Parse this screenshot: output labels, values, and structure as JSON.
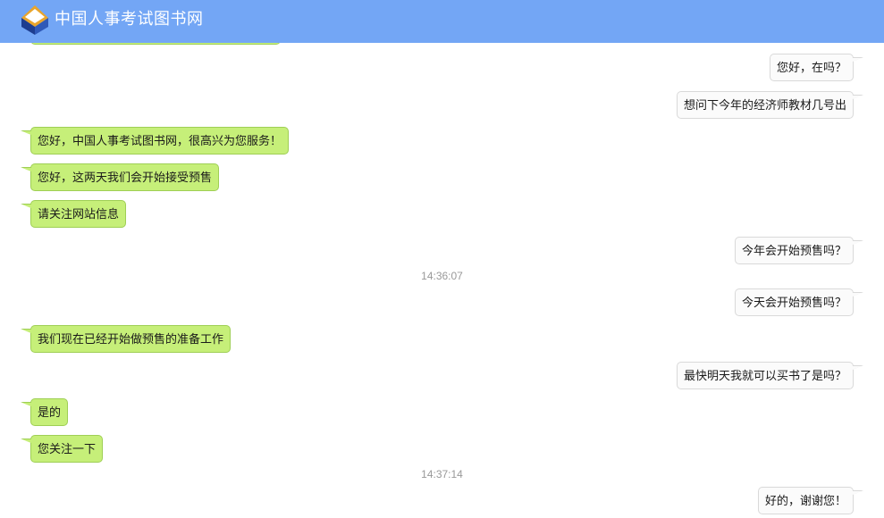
{
  "header": {
    "brand_name": "中国人事考试图书网",
    "logo_icon": "book-logo-icon",
    "background_color": "#73a6f5"
  },
  "conversation": {
    "colors": {
      "service_bubble": "#c6ef79",
      "customer_bubble": "#fbfbfb",
      "timestamp_text": "#999999"
    },
    "messages": [
      {
        "sender": "customer",
        "text": "您好，在吗？"
      },
      {
        "sender": "customer",
        "text": "想问下今年的经济师教材几号出"
      },
      {
        "sender": "service",
        "text": "您好，中国人事考试图书网，很高兴为您服务！"
      },
      {
        "sender": "service",
        "text": "您好，这两天我们会开始接受预售"
      },
      {
        "sender": "service",
        "text": "请关注网站信息"
      },
      {
        "sender": "customer",
        "text": "今年会开始预售吗？"
      },
      {
        "sender": "customer",
        "text": "今天会开始预售吗？"
      },
      {
        "sender": "service",
        "text": "我们现在已经开始做预售的准备工作"
      },
      {
        "sender": "customer",
        "text": "最快明天我就可以买书了是吗？"
      },
      {
        "sender": "service",
        "text": "是的"
      },
      {
        "sender": "service",
        "text": "您关注一下"
      },
      {
        "sender": "customer",
        "text": "好的，谢谢您！"
      }
    ],
    "timestamps": [
      "14:36:07",
      "14:37:14"
    ]
  }
}
